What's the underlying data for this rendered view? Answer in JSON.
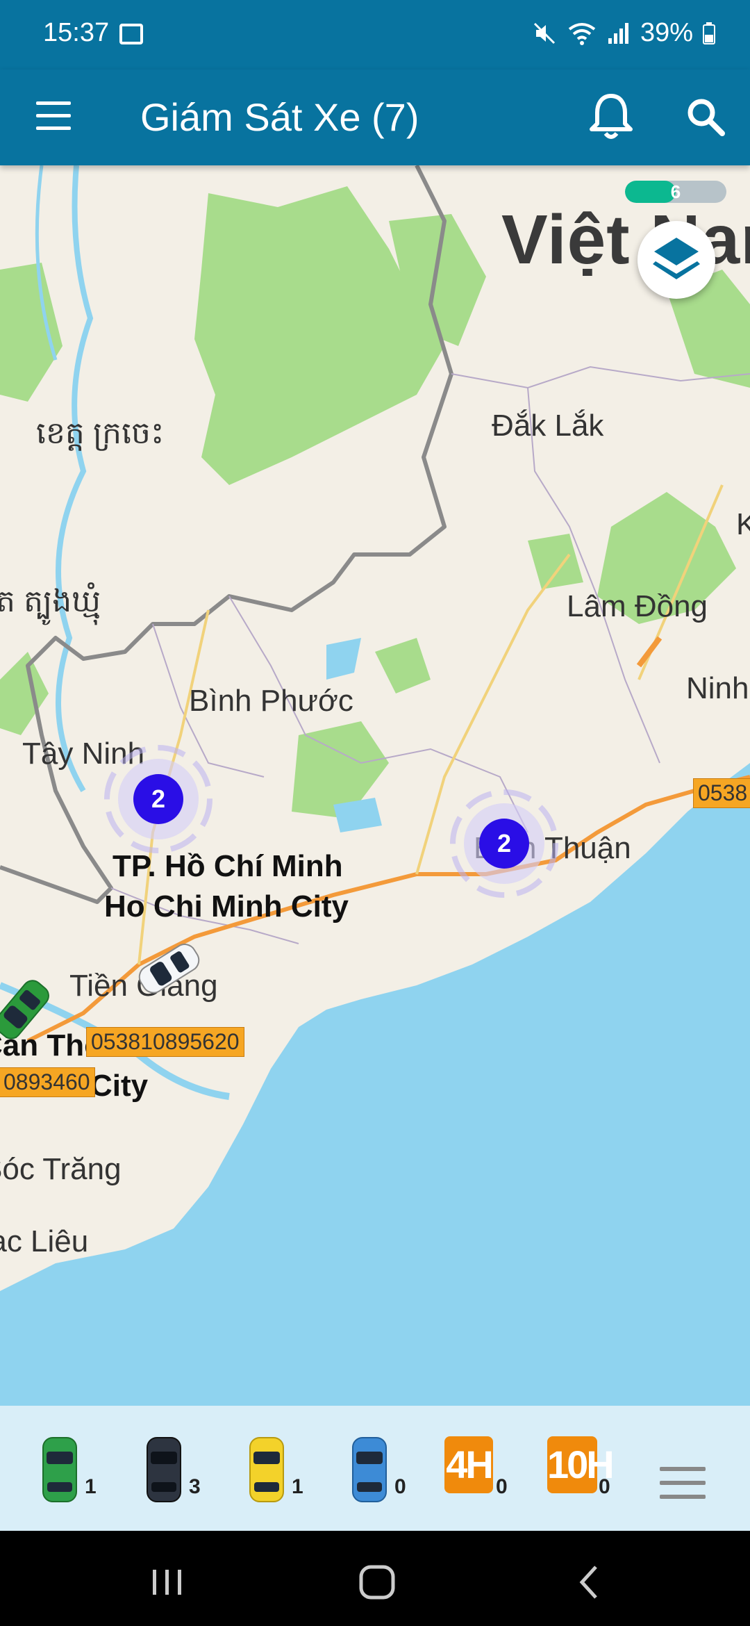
{
  "status_bar": {
    "time": "15:37",
    "battery": "39%"
  },
  "app_bar": {
    "title": "Giám Sát Xe (7)"
  },
  "map": {
    "loading_progress": {
      "label": "6",
      "fraction": 0.5
    },
    "labels": {
      "vietnam": "Việt Nam",
      "dak_lak": "Đắk Lắk",
      "lam_dong": "Lâm Đồng",
      "binh_phuoc": "Bình Phước",
      "tay_ninh": "Tây Ninh",
      "ninh": "Ninh",
      "binh_thuan": "Bình Thuận",
      "hcm_vi": "TP. Hồ Chí Minh",
      "hcm_en": "Ho Chi Minh City",
      "tien_giang": "Tiền Giang",
      "can_tho": "Cần Thơ",
      "city": "City",
      "soc_trang": "Sóc Trăng",
      "bac_lieu": "Bạc Liêu",
      "khmer_1": "ខេត្ត ក្រចេះ",
      "khmer_2": "ត ត្បូងឃ្មុំ",
      "k": "K"
    },
    "clusters": [
      {
        "count": "2"
      },
      {
        "count": "2"
      }
    ],
    "plates": {
      "p1": "053810895620",
      "p2": "0893460",
      "p3": "0538"
    }
  },
  "legend": {
    "green_count": "1",
    "black_count": "3",
    "yellow_count": "1",
    "blue_count": "0",
    "h4_label": "4H",
    "h4_count": "0",
    "h10_label": "10H",
    "h10_count": "0"
  },
  "colors": {
    "primary": "#08739f",
    "sea": "#8fd3ef",
    "land": "#f3efe6",
    "forest": "#a8dc8c",
    "cluster": "#2a0ee6",
    "plate": "#f6a623",
    "legend_bg": "#d9eef8"
  }
}
